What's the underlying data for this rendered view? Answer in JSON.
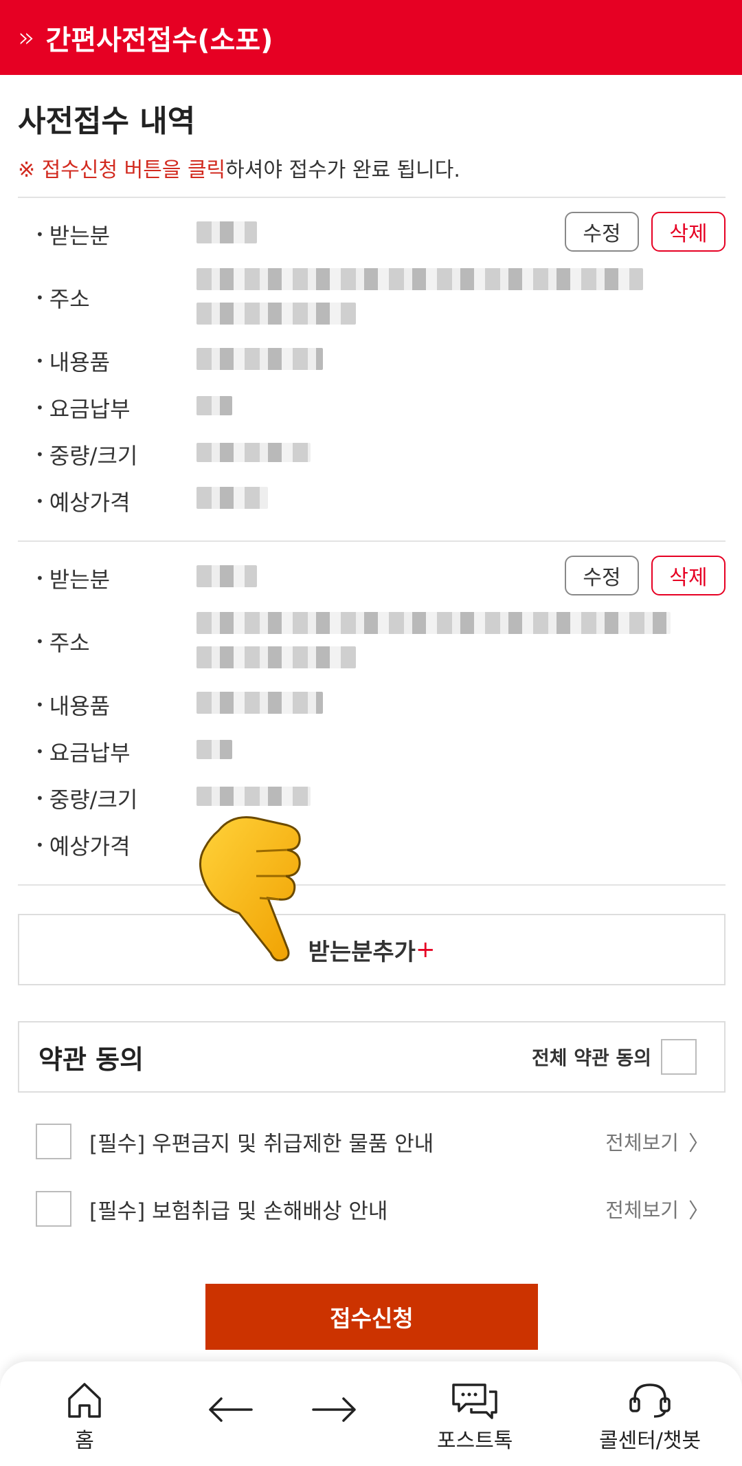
{
  "header": {
    "title": "간편사전접수(소포)"
  },
  "page": {
    "title": "사전접수 내역",
    "notice_mark": "※ ",
    "notice_highlight": "접수신청 버튼을 클릭",
    "notice_rest": "하셔야 접수가 완료 됩니다."
  },
  "records": [
    {
      "labels": [
        "받는분",
        "주소",
        "내용품",
        "요금납부",
        "중량/크기",
        "예상가격"
      ],
      "edit_label": "수정",
      "delete_label": "삭제"
    },
    {
      "labels": [
        "받는분",
        "주소",
        "내용품",
        "요금납부",
        "중량/크기",
        "예상가격"
      ],
      "edit_label": "수정",
      "delete_label": "삭제"
    }
  ],
  "add_recipient": {
    "label": "받는분추가",
    "plus": "+"
  },
  "terms": {
    "title": "약관 동의",
    "agree_all": "전체 약관 동의",
    "items": [
      {
        "label": "[필수] 우편금지 및 취급제한 물품 안내",
        "view": "전체보기"
      },
      {
        "label": "[필수] 보험취급 및 손해배상 안내",
        "view": "전체보기"
      }
    ]
  },
  "submit_label": "접수신청",
  "nav": {
    "home": "홈",
    "posttalk": "포스트톡",
    "callcenter": "콜센터/챗봇"
  },
  "colors": {
    "brand": "#e60023",
    "submit": "#cc3300"
  }
}
